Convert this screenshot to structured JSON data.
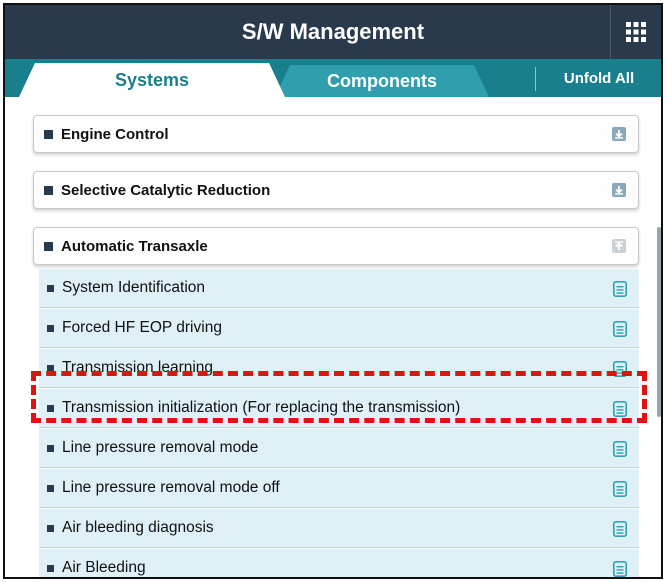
{
  "window": {
    "title": "S/W Management"
  },
  "icons": {
    "grid": "grid-menu-icon",
    "expand": "expand-down-icon",
    "collapse": "collapse-up-icon",
    "document": "document-icon"
  },
  "tabs": [
    {
      "label": "Systems",
      "active": true
    },
    {
      "label": "Components",
      "active": false
    }
  ],
  "toolbar": {
    "unfold_label": "Unfold All"
  },
  "groups": [
    {
      "label": "Engine Control",
      "expanded": false
    },
    {
      "label": "Selective Catalytic Reduction",
      "expanded": false
    },
    {
      "label": "Automatic Transaxle",
      "expanded": true
    }
  ],
  "items": [
    {
      "label": "System Identification"
    },
    {
      "label": "Forced HF EOP driving"
    },
    {
      "label": "Transmission learning"
    },
    {
      "label": "Transmission initialization (For replacing the transmission)"
    },
    {
      "label": "Line pressure removal mode"
    },
    {
      "label": "Line pressure removal mode off",
      "highlighted": true
    },
    {
      "label": "Air bleeding diagnosis"
    },
    {
      "label": "Air Bleeding"
    }
  ],
  "colors": {
    "titlebar": "#293a4c",
    "tabbar": "#1a7f8c",
    "tab_inactive": "#2f9fae",
    "item_bg": "#dff0f6",
    "icon_teal": "#2aa3b8",
    "highlight": "#e01212"
  }
}
